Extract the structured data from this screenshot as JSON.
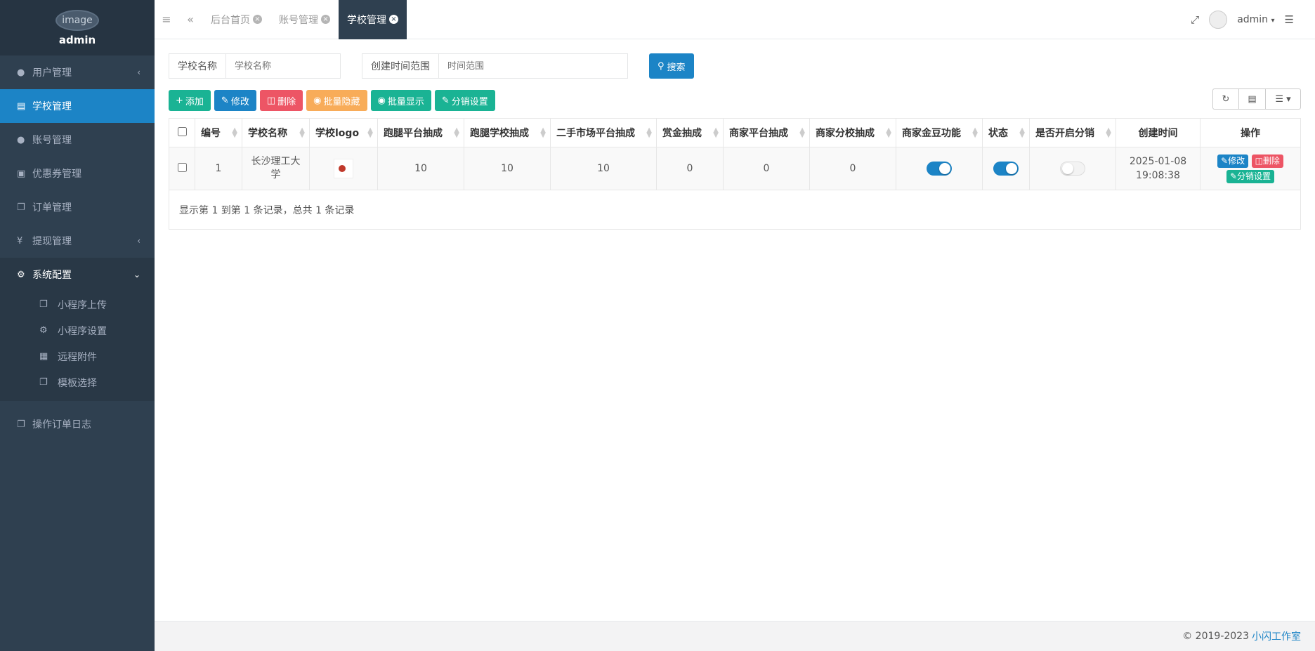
{
  "brand": {
    "logo_alt": "image",
    "username": "admin"
  },
  "sidebar": {
    "items": [
      {
        "label": "用户管理",
        "icon": "user-icon"
      },
      {
        "label": "学校管理",
        "icon": "list-icon"
      },
      {
        "label": "账号管理",
        "icon": "users-icon"
      },
      {
        "label": "优惠券管理",
        "icon": "coupon-icon"
      },
      {
        "label": "订单管理",
        "icon": "copy-icon"
      },
      {
        "label": "提现管理",
        "icon": "yen-icon"
      },
      {
        "label": "系统配置",
        "icon": "gear-icon"
      }
    ],
    "subitems": [
      {
        "label": "小程序上传",
        "icon": "copy-icon"
      },
      {
        "label": "小程序设置",
        "icon": "gear-icon"
      },
      {
        "label": "远程附件",
        "icon": "image-icon"
      },
      {
        "label": "模板选择",
        "icon": "copy-icon"
      }
    ],
    "bottom_item": {
      "label": "操作订单日志",
      "icon": "copy-icon"
    }
  },
  "topbar": {
    "tabs": [
      {
        "label": "后台首页"
      },
      {
        "label": "账号管理"
      },
      {
        "label": "学校管理"
      }
    ],
    "user": "admin"
  },
  "search": {
    "school_label": "学校名称",
    "school_placeholder": "学校名称",
    "time_label": "创建时间范围",
    "time_placeholder": "时间范围",
    "search_button": "搜索"
  },
  "toolbar": {
    "add": "添加",
    "edit": "修改",
    "delete": "删除",
    "batch_hide": "批量隐藏",
    "batch_show": "批量显示",
    "distribution": "分销设置"
  },
  "table": {
    "headers": [
      "编号",
      "学校名称",
      "学校logo",
      "跑腿平台抽成",
      "跑腿学校抽成",
      "二手市场平台抽成",
      "赏金抽成",
      "商家平台抽成",
      "商家分校抽成",
      "商家金豆功能",
      "状态",
      "是否开启分销",
      "创建时间",
      "操作"
    ],
    "rows": [
      {
        "id": "1",
        "school_name": "长沙理工大学",
        "errand_platform": "10",
        "errand_school": "10",
        "secondhand_platform": "10",
        "bounty": "0",
        "merchant_platform": "0",
        "merchant_school": "0",
        "gold_bean": true,
        "status": true,
        "distribution_enabled": false,
        "created_date": "2025-01-08",
        "created_time": "19:08:38",
        "actions": {
          "edit": "修改",
          "delete": "删除",
          "distribution": "分销设置"
        }
      }
    ],
    "footer": "显示第 1 到第 1 条记录，总共 1 条记录"
  },
  "footer": {
    "copyright": "© 2019-2023",
    "studio": "小闪工作室"
  }
}
